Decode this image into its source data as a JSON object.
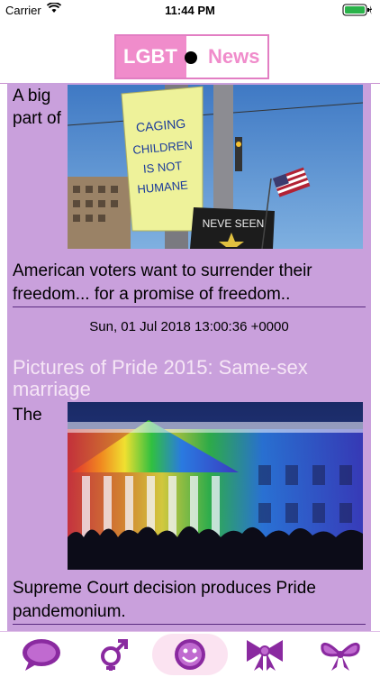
{
  "status": {
    "carrier": "Carrier",
    "time": "11:44 PM"
  },
  "header": {
    "logo_left": "LGBT",
    "logo_right": "News"
  },
  "articles": [
    {
      "side_text": "A big part of",
      "sign_text": "CAGING CHILDREN IS NOT HUMANE",
      "sign2_text": "NEVE SEEN",
      "caption": "American voters want to surrender their freedom... for a promise of freedom..",
      "date": "Sun, 01 Jul 2018 13:00:36 +0000"
    },
    {
      "title": "Pictures of Pride 2015: Same-sex marriage",
      "side_text": "The",
      "caption": "Supreme Court decision produces Pride pandemonium."
    }
  ],
  "tabs": [
    "chat-icon",
    "gender-icon",
    "smiley-icon",
    "ribbon-icon",
    "bow-icon"
  ],
  "colors": {
    "accent": "#f08ccb",
    "feed_bg": "#c9a0dc",
    "tab_icon": "#8a2aa0"
  }
}
